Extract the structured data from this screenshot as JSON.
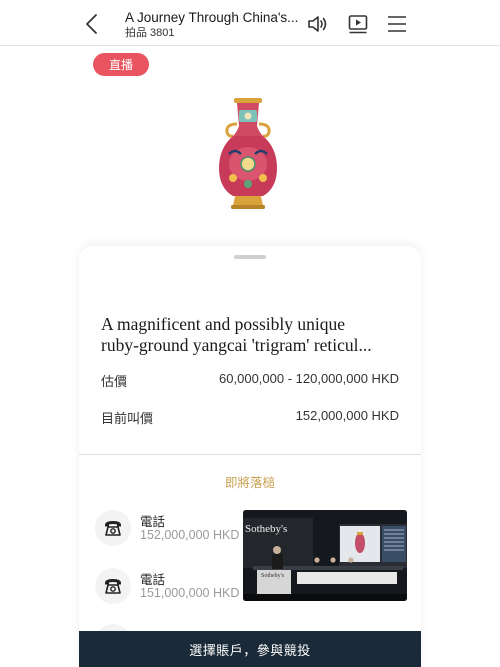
{
  "header": {
    "title": "A Journey Through China's...",
    "subtitle": "拍品 3801"
  },
  "image_section": {
    "live_badge": "直播"
  },
  "lot": {
    "title_line1": "A magnificent and possibly unique",
    "title_line2": "ruby-ground yangcai 'trigram' reticul...",
    "estimate_label": "估價",
    "estimate_value": "60,000,000 - 120,000,000 HKD",
    "current_bid_label": "目前叫價",
    "current_bid_value": "152,000,000 HKD"
  },
  "closing_status": "即將落槌",
  "bids": [
    {
      "label": "電話",
      "amount": "152,000,000 HKD"
    },
    {
      "label": "電話",
      "amount": "151,000,000 HKD"
    }
  ],
  "video": {
    "brand": "Sotheby's",
    "podium_label": "Sotheby's"
  },
  "cta_label": "選擇賬戶，參與競投",
  "colors": {
    "live_badge": "#e85560",
    "closing_text": "#c9a053",
    "cta_background": "#1a2a38"
  }
}
